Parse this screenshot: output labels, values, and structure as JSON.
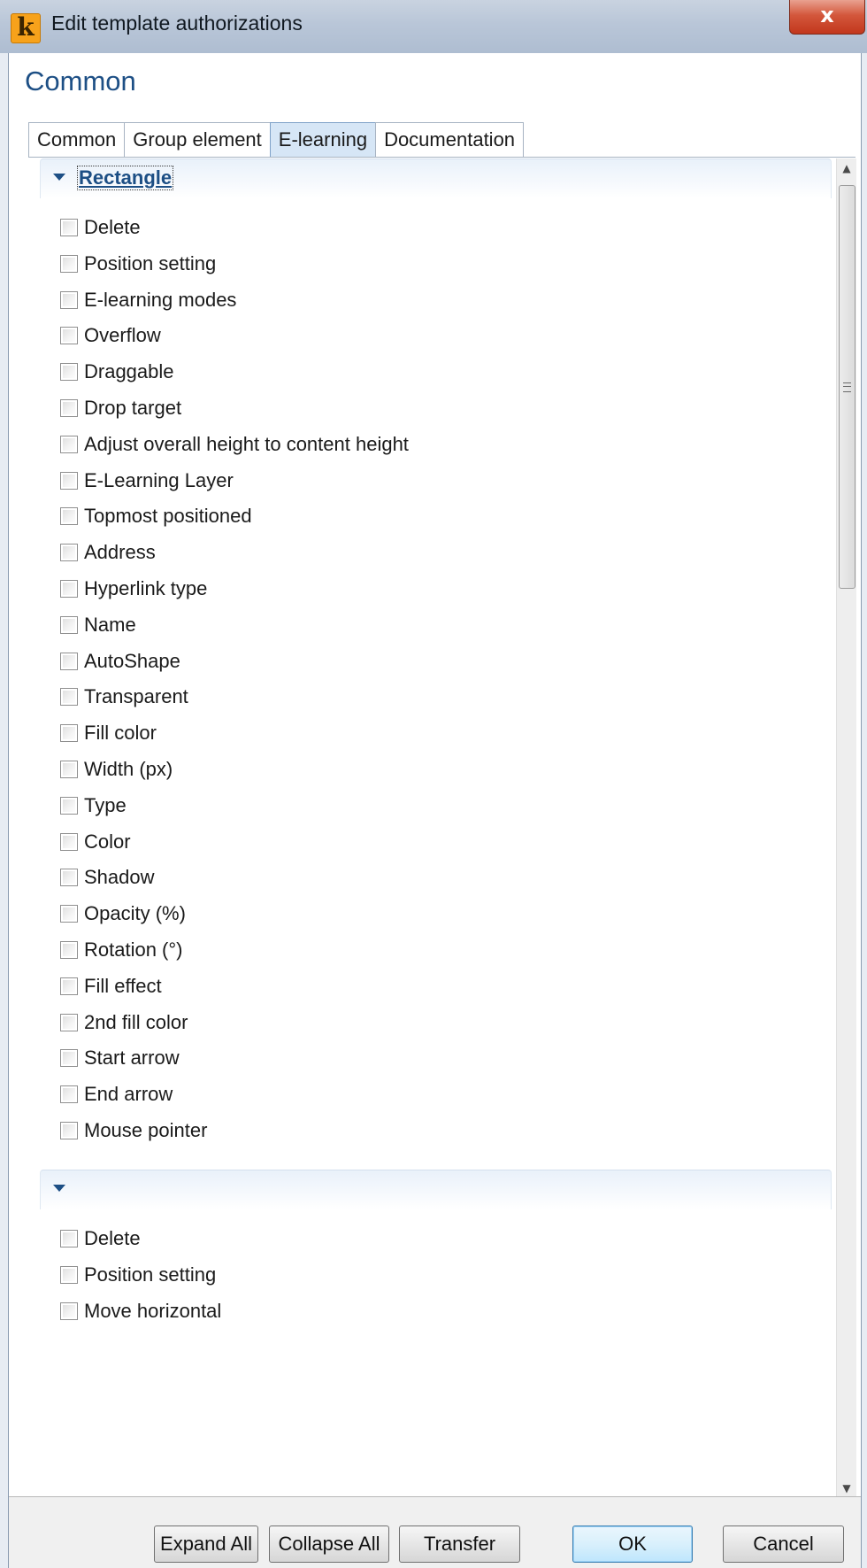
{
  "window": {
    "title": "Edit template authorizations",
    "close_label": "x"
  },
  "heading": "Common",
  "tabs": [
    {
      "label": "Common",
      "active": false
    },
    {
      "label": "Group element",
      "active": false
    },
    {
      "label": "E-learning",
      "active": true
    },
    {
      "label": "Documentation",
      "active": false
    }
  ],
  "sections": [
    {
      "title": "Rectangle",
      "expanded": true,
      "items": [
        {
          "label": "Delete",
          "checked": false
        },
        {
          "label": "Position setting",
          "checked": false
        },
        {
          "label": "E-learning modes",
          "checked": false
        },
        {
          "label": "Overflow",
          "checked": false
        },
        {
          "label": "Draggable",
          "checked": false
        },
        {
          "label": "Drop target",
          "checked": false
        },
        {
          "label": "Adjust overall height to content height",
          "checked": false
        },
        {
          "label": "E-Learning Layer",
          "checked": false
        },
        {
          "label": "Topmost positioned",
          "checked": false
        },
        {
          "label": "Address",
          "checked": false
        },
        {
          "label": "Hyperlink type",
          "checked": false
        },
        {
          "label": "Name",
          "checked": false
        },
        {
          "label": "AutoShape",
          "checked": false
        },
        {
          "label": "Transparent",
          "checked": false
        },
        {
          "label": "Fill color",
          "checked": false
        },
        {
          "label": "Width (px)",
          "checked": false
        },
        {
          "label": "Type",
          "checked": false
        },
        {
          "label": "Color",
          "checked": false
        },
        {
          "label": "Shadow",
          "checked": false
        },
        {
          "label": "Opacity (%)",
          "checked": false
        },
        {
          "label": "Rotation (°)",
          "checked": false
        },
        {
          "label": "Fill effect",
          "checked": false
        },
        {
          "label": "2nd fill color",
          "checked": false
        },
        {
          "label": "Start arrow",
          "checked": false
        },
        {
          "label": "End arrow",
          "checked": false
        },
        {
          "label": "Mouse pointer",
          "checked": false
        }
      ]
    },
    {
      "title": "",
      "expanded": true,
      "items": [
        {
          "label": "Delete",
          "checked": false
        },
        {
          "label": "Position setting",
          "checked": false
        },
        {
          "label": "Move horizontal",
          "checked": false
        }
      ]
    }
  ],
  "scrollbar": {
    "up_icon": "▲",
    "down_icon": "▼"
  },
  "buttons": {
    "expand_all": "Expand All",
    "collapse_all": "Collapse All",
    "transfer": "Transfer",
    "ok": "OK",
    "cancel": "Cancel"
  }
}
